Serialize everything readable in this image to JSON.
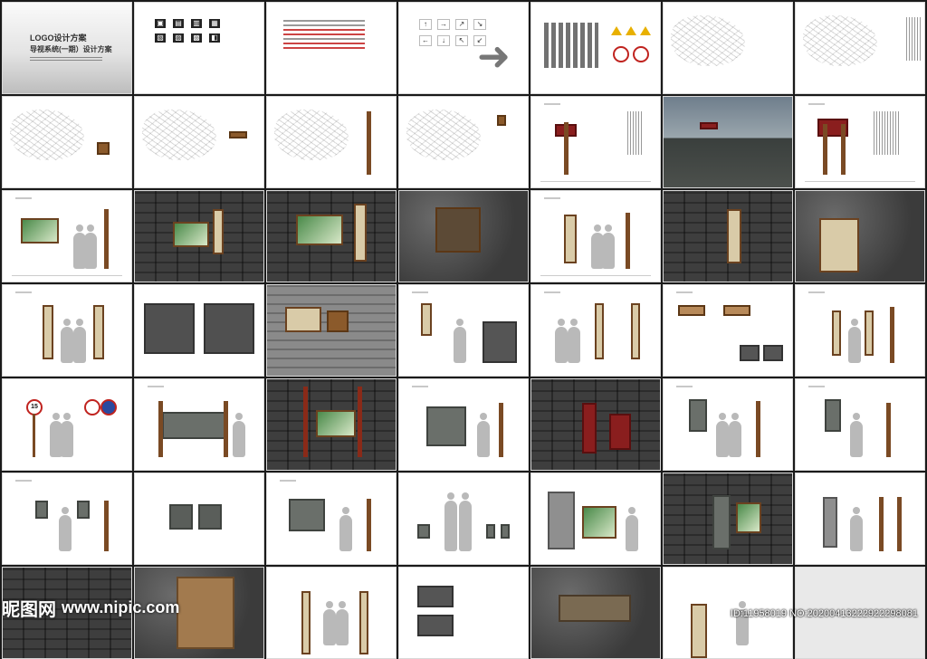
{
  "cover": {
    "title": "LOGO设计方案",
    "subtitle": "导视系统(一期）设计方案"
  },
  "signs": {
    "speed_limit": "15"
  },
  "watermark": {
    "logo_text": "昵图网",
    "site": "www.nipic.com",
    "id_text": "ID:11958019 NO:20200413222922298081"
  }
}
